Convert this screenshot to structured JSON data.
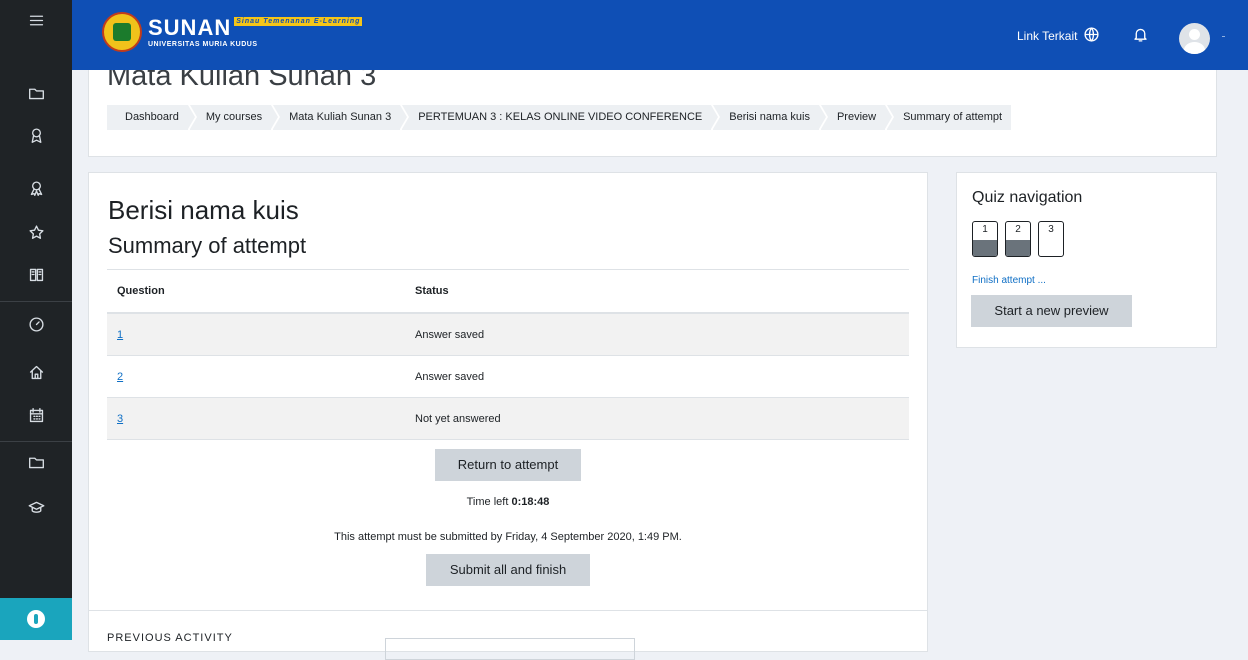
{
  "rail": {
    "items": [
      {
        "icon": "folder-icon"
      },
      {
        "icon": "badge-icon"
      },
      {
        "icon": "award-icon"
      },
      {
        "icon": "star-icon"
      },
      {
        "icon": "book-icon"
      },
      {
        "icon": "dashboard-icon"
      },
      {
        "icon": "home-icon"
      },
      {
        "icon": "calendar-icon"
      },
      {
        "icon": "folder-icon"
      },
      {
        "icon": "graduation-cap-icon"
      }
    ],
    "bottom_icon": "accessibility-icon"
  },
  "topbar": {
    "logo_main": "SUNAN",
    "logo_tag": "Sinau Temenanan E-Learning",
    "logo_sub": "UNIVERSITAS MURIA KUDUS",
    "link_label": "Link Terkait",
    "icons": [
      "globe-icon",
      "bell-icon",
      "avatar"
    ],
    "bg_color": "#0f4fb5"
  },
  "header": {
    "course_title": "Mata Kuliah Sunan 3",
    "breadcrumbs": [
      "Dashboard",
      "My courses",
      "Mata Kuliah Sunan 3",
      "PERTEMUAN 3 : KELAS ONLINE VIDEO CONFERENCE",
      "Berisi nama kuis",
      "Preview",
      "Summary of attempt"
    ]
  },
  "main": {
    "quiz_name": "Berisi nama kuis",
    "summary_title": "Summary of attempt",
    "table": {
      "headers": [
        "Question",
        "Status"
      ],
      "rows": [
        {
          "question": "1",
          "status": "Answer saved"
        },
        {
          "question": "2",
          "status": "Answer saved"
        },
        {
          "question": "3",
          "status": "Not yet answered"
        }
      ]
    },
    "return_button": "Return to attempt",
    "time_left_label": "Time left",
    "time_left_value": "0:18:48",
    "deadline_text": "This attempt must be submitted by Friday, 4 September 2020, 1:49 PM.",
    "submit_button": "Submit all and finish",
    "previous_activity_label": "PREVIOUS ACTIVITY"
  },
  "quiz_nav": {
    "title": "Quiz navigation",
    "questions": [
      {
        "number": "1",
        "state": "saved"
      },
      {
        "number": "2",
        "state": "saved"
      },
      {
        "number": "3",
        "state": "unanswered"
      }
    ],
    "finish_link": "Finish attempt ...",
    "new_preview_button": "Start a new preview"
  }
}
